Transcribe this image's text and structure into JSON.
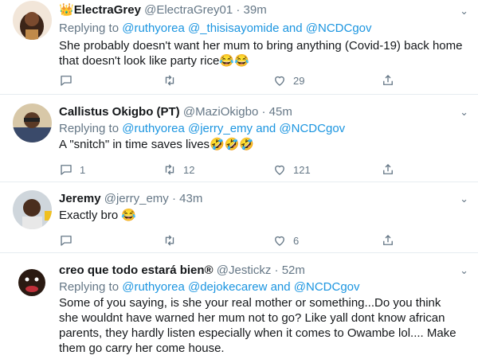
{
  "tweets": [
    {
      "name": "ElectraGrey",
      "handle": "@ElectraGrey01",
      "dot": "·",
      "time": "39m",
      "replying_prefix": "Replying to",
      "replying_mentions": "@ruthyorea @_thisisayomide and @NCDCgov",
      "text": "She probably doesn't want her mum to bring anything (Covid-19) back home that doesn't look like party rice😂😂",
      "comments": "",
      "retweets": "",
      "likes": "29",
      "name_emoji": "👑"
    },
    {
      "name": "Callistus Okigbo (PT)",
      "handle": "@MaziOkigbo",
      "dot": "·",
      "time": "45m",
      "replying_prefix": "Replying to",
      "replying_mentions": "@ruthyorea @jerry_emy and @NCDCgov",
      "text": "A \"snitch\" in time saves lives🤣🤣🤣",
      "comments": "1",
      "retweets": "12",
      "likes": "121"
    },
    {
      "name": "Jeremy",
      "handle": "@jerry_emy",
      "dot": "·",
      "time": "43m",
      "text": "Exactly bro 😂",
      "comments": "",
      "retweets": "",
      "likes": "6"
    },
    {
      "name": "creo que todo estará bien®",
      "handle": "@Jestickz",
      "dot": "·",
      "time": "52m",
      "replying_prefix": "Replying to",
      "replying_mentions": "@ruthyorea @dejokecarew and @NCDCgov",
      "text": "Some of you saying, is she your real mother or something...Do you think she wouldnt have warned her mum not to go? Like yall dont know african parents, they hardly listen especially when it comes to Owambe lol.... Make them go carry her come house."
    }
  ],
  "colors": {
    "link": "#1b95e0",
    "muted": "#657786",
    "divider": "#e6ecf0"
  },
  "icons": [
    "comment-icon",
    "retweet-icon",
    "like-icon",
    "share-icon",
    "chevron-down-icon"
  ]
}
